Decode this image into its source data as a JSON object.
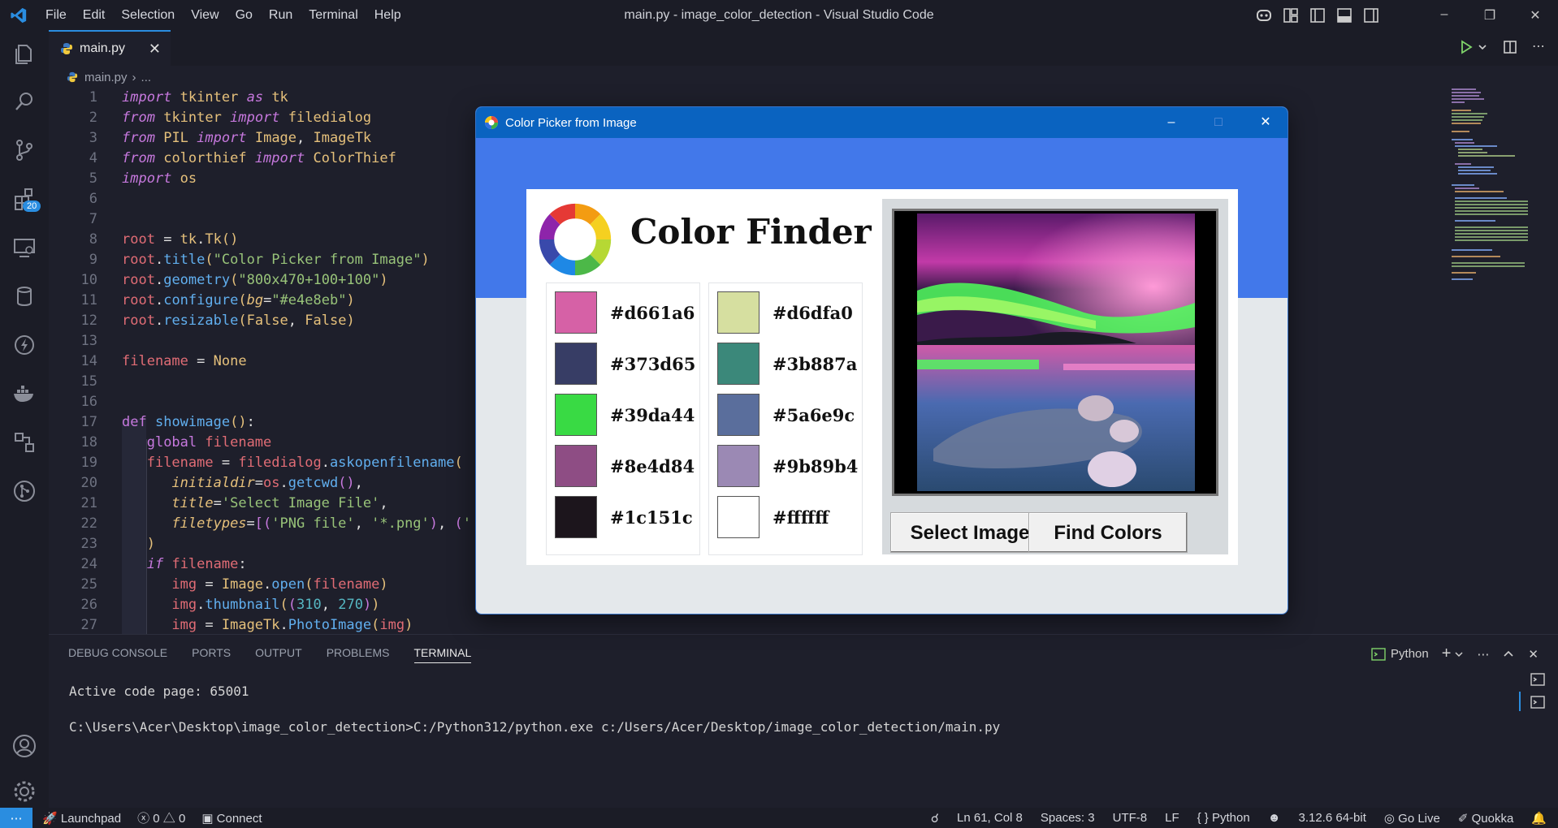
{
  "window": {
    "title": "main.py - image_color_detection - Visual Studio Code",
    "menu": [
      "File",
      "Edit",
      "Selection",
      "View",
      "Go",
      "Run",
      "Terminal",
      "Help"
    ]
  },
  "activity_bar": {
    "items": [
      "explorer-icon",
      "search-icon",
      "source-control-icon",
      "extensions-icon",
      "remote-explorer-icon",
      "database-icon",
      "lightning-icon",
      "docker-icon",
      "extensions-grid-icon",
      "git-graph-icon",
      "account-icon",
      "settings-gear-icon"
    ],
    "extensions_badge": "20"
  },
  "tabs": [
    {
      "label": "main.py",
      "active": true
    }
  ],
  "breadcrumb": {
    "file": "main.py",
    "rest": "..."
  },
  "editor": {
    "line_numbers": [
      "1",
      "2",
      "3",
      "4",
      "5",
      "6",
      "7",
      "8",
      "9",
      "10",
      "11",
      "12",
      "13",
      "14",
      "15",
      "16",
      "17",
      "18",
      "19",
      "20",
      "21",
      "22",
      "23",
      "24",
      "25",
      "26",
      "27"
    ]
  },
  "panel": {
    "tabs": [
      "DEBUG CONSOLE",
      "PORTS",
      "OUTPUT",
      "PROBLEMS",
      "TERMINAL"
    ],
    "active_tab": "TERMINAL",
    "terminal_profile": "Python",
    "terminal_lines": [
      "Active code page: 65001",
      "C:\\Users\\Acer\\Desktop\\image_color_detection>C:/Python312/python.exe c:/Users/Acer/Desktop/image_color_detection/main.py"
    ]
  },
  "status": {
    "launchpad": "Launchpad",
    "errors": "0",
    "warnings": "0",
    "connect": "Connect",
    "position": "Ln 61, Col 8",
    "spaces": "Spaces: 3",
    "encoding": "UTF-8",
    "eol": "LF",
    "language": "Python",
    "interpreter": "3.12.6 64-bit",
    "go_live": "Go Live",
    "quokka": "Quokka"
  },
  "app": {
    "title": "Color Picker from Image",
    "heading": "Color Finder",
    "select_button": "Select Image",
    "find_button": "Find Colors",
    "colors_left": [
      {
        "hex": "#d661a6",
        "color": "#d661a6"
      },
      {
        "hex": "#373d65",
        "color": "#373d65"
      },
      {
        "hex": "#39da44",
        "color": "#39da44"
      },
      {
        "hex": "#8e4d84",
        "color": "#8e4d84"
      },
      {
        "hex": "#1c151c",
        "color": "#1c151c"
      }
    ],
    "colors_right": [
      {
        "hex": "#d6dfa0",
        "color": "#d6dfa0"
      },
      {
        "hex": "#3b887a",
        "color": "#3b887a"
      },
      {
        "hex": "#5a6e9c",
        "color": "#5a6e9c"
      },
      {
        "hex": "#9b89b4",
        "color": "#9b89b4"
      },
      {
        "hex": "#ffffff",
        "color": "#ffffff"
      }
    ]
  }
}
